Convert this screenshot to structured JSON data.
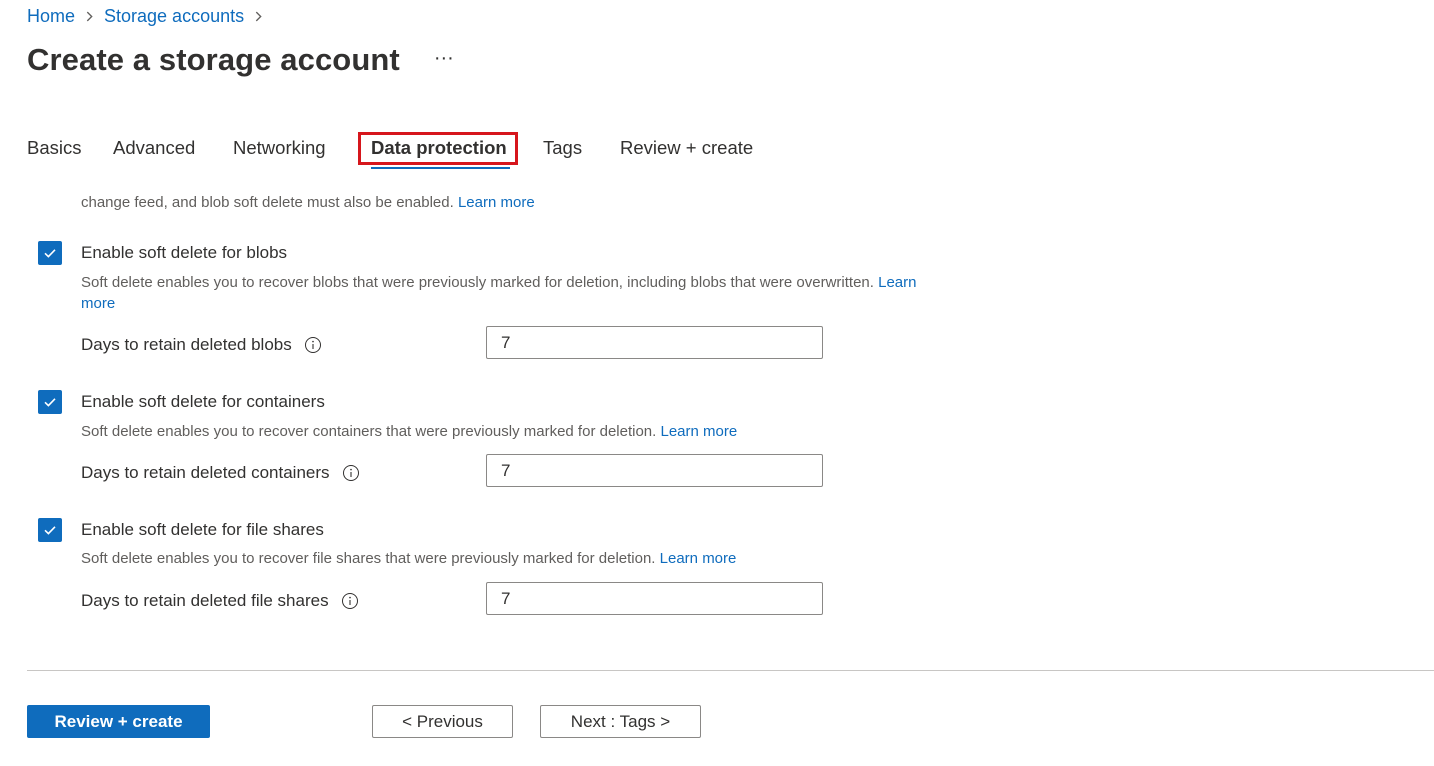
{
  "breadcrumb": {
    "items": [
      "Home",
      "Storage accounts"
    ]
  },
  "header": {
    "title": "Create a storage account",
    "more_icon": "···"
  },
  "tabs": [
    {
      "label": "Basics",
      "active": false
    },
    {
      "label": "Advanced",
      "active": false
    },
    {
      "label": "Networking",
      "active": false
    },
    {
      "label": "Data protection",
      "active": true
    },
    {
      "label": "Tags",
      "active": false
    },
    {
      "label": "Review + create",
      "active": false
    }
  ],
  "colors": {
    "accent": "#0f6cbd",
    "highlight": "#d6161c",
    "text": "#323130",
    "muted": "#605e5c"
  },
  "intro": {
    "text": "change feed, and blob soft delete must also be enabled.",
    "link": "Learn more"
  },
  "sections": [
    {
      "checkbox_label": "Enable soft delete for blobs",
      "checked": true,
      "description_line1": "Soft delete enables you to recover blobs that were previously marked for deletion, including blobs that were overwritten.",
      "link_part1": "Learn",
      "link_part2": "more",
      "field_label": "Days to retain deleted blobs",
      "field_value": "7"
    },
    {
      "checkbox_label": "Enable soft delete for containers",
      "checked": true,
      "description": "Soft delete enables you to recover containers that were previously marked for deletion.",
      "link": "Learn more",
      "field_label": "Days to retain deleted containers",
      "field_value": "7"
    },
    {
      "checkbox_label": "Enable soft delete for file shares",
      "checked": true,
      "description": "Soft delete enables you to recover file shares that were previously marked for deletion.",
      "link": "Learn more",
      "field_label": "Days to retain deleted file shares",
      "field_value": "7"
    }
  ],
  "footer": {
    "review_create": "Review + create",
    "previous": "< Previous",
    "next": "Next : Tags >"
  }
}
